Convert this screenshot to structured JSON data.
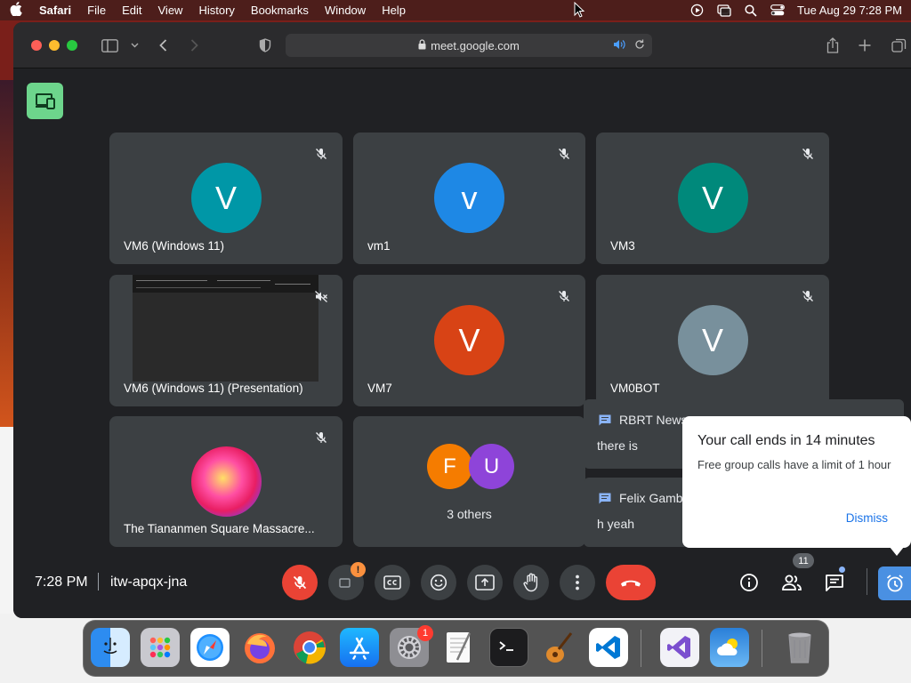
{
  "menubar": {
    "app_name": "Safari",
    "items": [
      "File",
      "Edit",
      "View",
      "History",
      "Bookmarks",
      "Window",
      "Help"
    ],
    "datetime": "Tue Aug 29  7:28 PM"
  },
  "browser": {
    "url": "meet.google.com"
  },
  "tiles": [
    {
      "name": "VM6 (Windows 11)",
      "initial": "V",
      "color": "#0097a7"
    },
    {
      "name": "vm1",
      "initial": "v",
      "color": "#1e88e5"
    },
    {
      "name": "VM3",
      "initial": "V",
      "color": "#00897b"
    },
    {
      "name": "VM6 (Windows 11) (Presentation)",
      "initial": "",
      "color": "#2a2a2a"
    },
    {
      "name": "VM7",
      "initial": "V",
      "color": "#d84315"
    },
    {
      "name": "VM0BOT",
      "initial": "V",
      "color": "#78909c"
    },
    {
      "name": "The Tiananmen Square Massacre...",
      "initial": "",
      "color": "#e91e63"
    }
  ],
  "others": {
    "avatars": [
      {
        "initial": "F",
        "color": "#f57c00"
      },
      {
        "initial": "U",
        "color": "#8e44d9"
      }
    ],
    "label": "3 others"
  },
  "chat_previews": [
    {
      "sender": "RBRT News",
      "message": "there is"
    },
    {
      "sender": "Felix Gambino",
      "message": "h yeah"
    }
  ],
  "notice": {
    "title": "Your call ends in 14 minutes",
    "body": "Free group calls have a limit of 1 hour",
    "dismiss_label": "Dismiss"
  },
  "bottom_bar": {
    "time": "7:28 PM",
    "meeting_code": "itw-apqx-jna",
    "camera_warning": "!",
    "participant_count": "11"
  },
  "dock": {
    "settings_badge": "1"
  }
}
